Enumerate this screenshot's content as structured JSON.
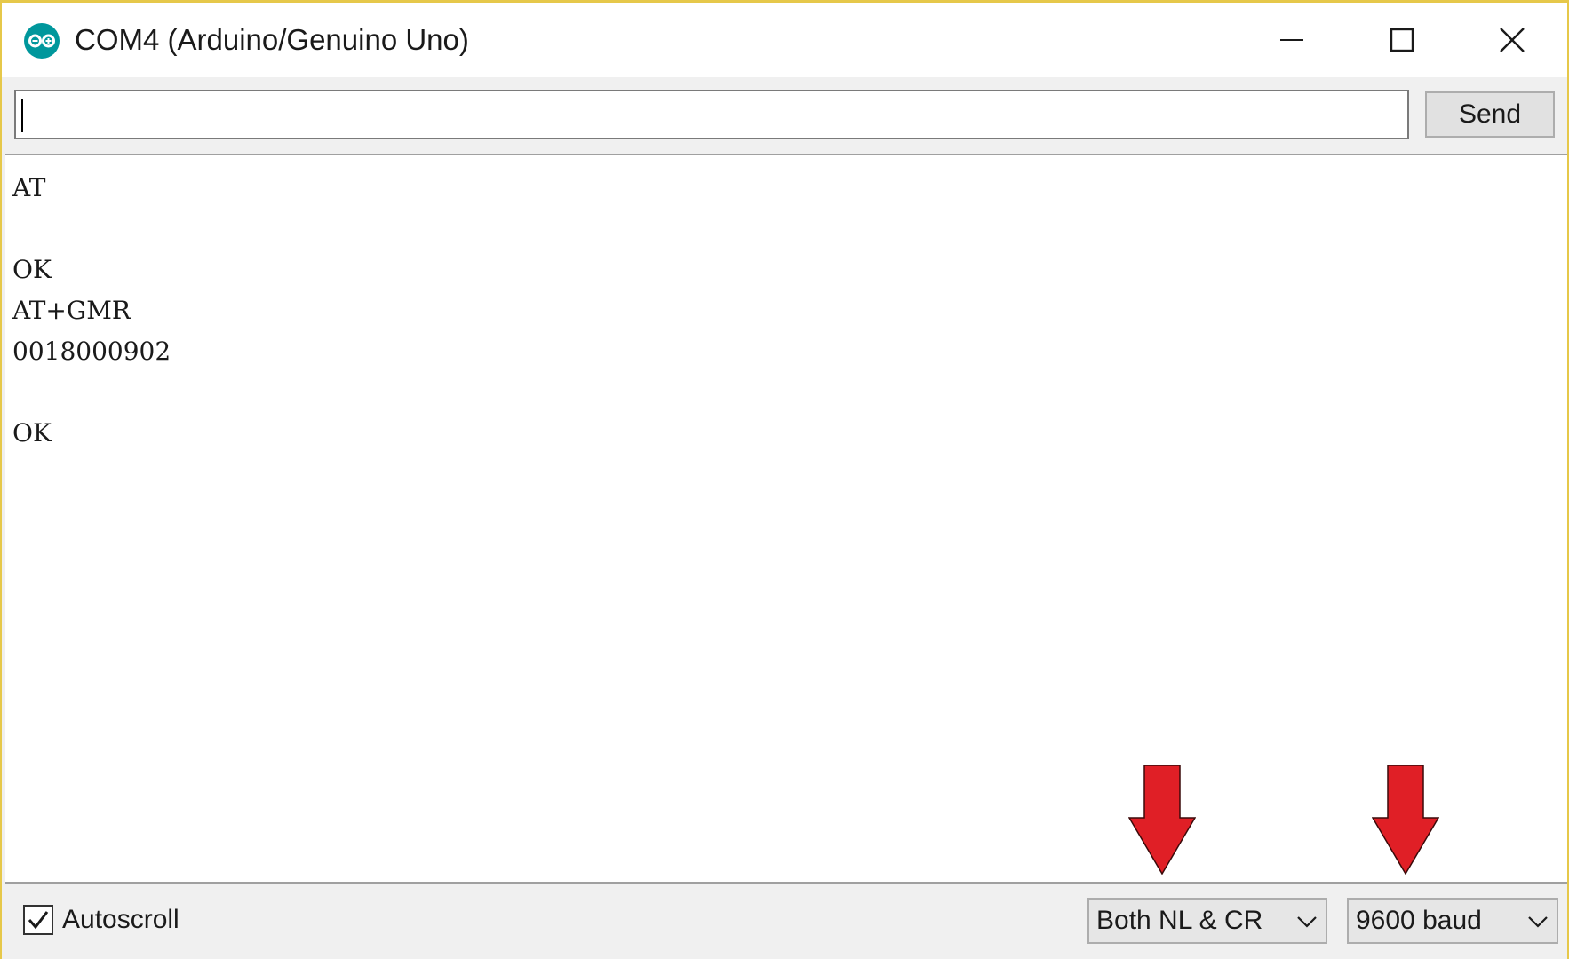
{
  "window": {
    "title": "COM4 (Arduino/Genuino Uno)"
  },
  "toolbar": {
    "input_value": "",
    "send_label": "Send"
  },
  "output": {
    "lines": [
      "AT",
      "",
      "OK",
      "AT+GMR",
      "0018000902",
      "",
      "OK"
    ]
  },
  "footer": {
    "autoscroll_label": "Autoscroll",
    "autoscroll_checked": true,
    "line_ending": "Both NL & CR",
    "baud_rate": "9600 baud"
  },
  "colors": {
    "annotation_arrow": "#e01f26",
    "window_border": "#e6c84a",
    "arduino_teal": "#00979c"
  },
  "icons": {
    "app": "arduino-logo-icon",
    "minimize": "minimize-icon",
    "maximize": "maximize-icon",
    "close": "close-icon",
    "checkbox": "checkmark-icon",
    "dropdown": "chevron-down-icon",
    "annotation": "red-down-arrow-icon"
  }
}
